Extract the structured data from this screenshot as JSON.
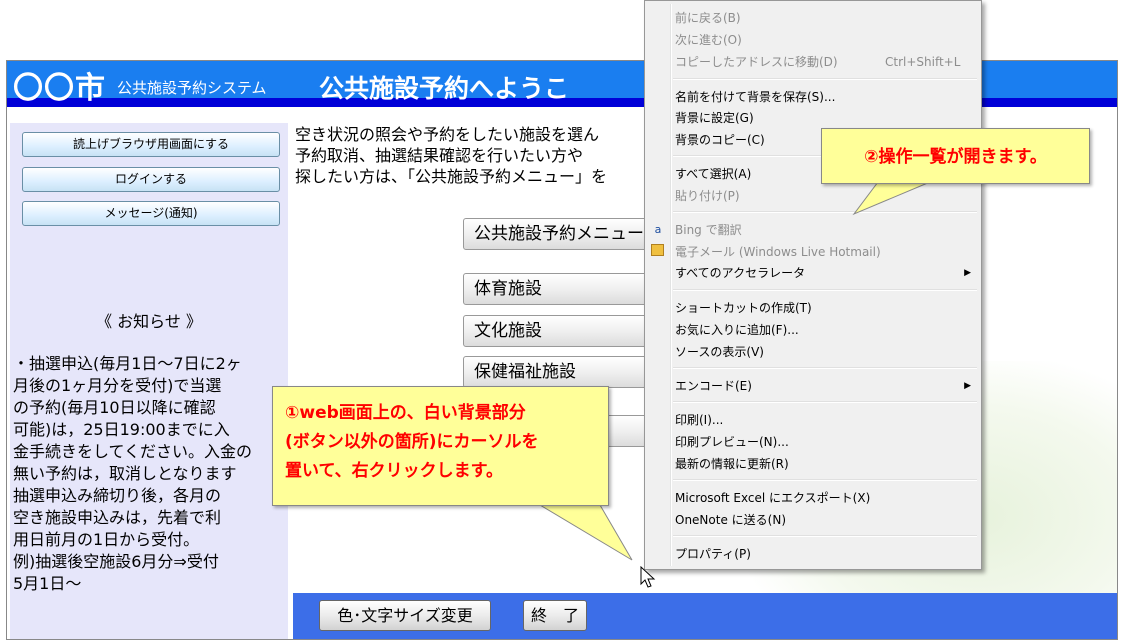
{
  "header": {
    "city": "〇〇市",
    "system": "公共施設予約システム",
    "welcome": "公共施設予約へようこ"
  },
  "sidebar": {
    "buttons": [
      "読上げブラウザ用画面にする",
      "ログインする",
      "メッセージ(通知)"
    ],
    "notice_title": "《 お知らせ 》",
    "notice_lines": [
      "・抽選申込(毎月1日～7日に2ヶ",
      "月後の1ヶ月分を受付)で当選",
      "の予約(毎月10日以降に確認",
      "可能)は，25日19:00までに入",
      "金手続きをしてください。入金の",
      "無い予約は，取消しとなります",
      "抽選申込み締切り後，各月の",
      "空き施設申込みは，先着で利",
      "用日前月の1日から受付。",
      "例)抽選後空施設6月分⇒受付",
      "5月1日～"
    ]
  },
  "main": {
    "intro_lines": [
      "空き状況の照会や予約をしたい施設を選ん",
      "予約取消、抽選結果確認を行いたい方や",
      "探したい方は、「公共施設予約メニュー」を"
    ],
    "facility_buttons": [
      "公共施設予約メニュー",
      "体育施設",
      "文化施設",
      "保健福祉施設",
      ""
    ]
  },
  "footer": {
    "color_button": "色･文字サイズ変更",
    "end_button": "終　了"
  },
  "context_menu": {
    "back": "前に戻る(B)",
    "forward": "次に進む(O)",
    "goto_copied": "コピーしたアドレスに移動(D)",
    "goto_copied_shortcut": "Ctrl+Shift+L",
    "save_bg": "名前を付けて背景を保存(S)...",
    "set_bg": "背景に設定(G)",
    "copy_bg": "背景のコピー(C)",
    "select_all": "すべて選択(A)",
    "paste": "貼り付け(P)",
    "bing": "Bing で翻訳",
    "email": "電子メール (Windows Live Hotmail)",
    "all_accel": "すべてのアクセラレータ",
    "shortcut": "ショートカットの作成(T)",
    "favorites": "お気に入りに追加(F)...",
    "view_source": "ソースの表示(V)",
    "encode": "エンコード(E)",
    "print": "印刷(I)...",
    "print_preview": "印刷プレビュー(N)...",
    "refresh": "最新の情報に更新(R)",
    "excel": "Microsoft Excel にエクスポート(X)",
    "onenote": "OneNote に送る(N)",
    "properties": "プロパティ(P)",
    "submenu_arrow": "▶"
  },
  "callouts": {
    "one_l1": "①web画面上の、白い背景部分",
    "one_l2": "(ボタン以外の箇所)にカーソルを",
    "one_l3": "置いて、右クリックします。",
    "two": "②操作一覧が開きます。"
  }
}
